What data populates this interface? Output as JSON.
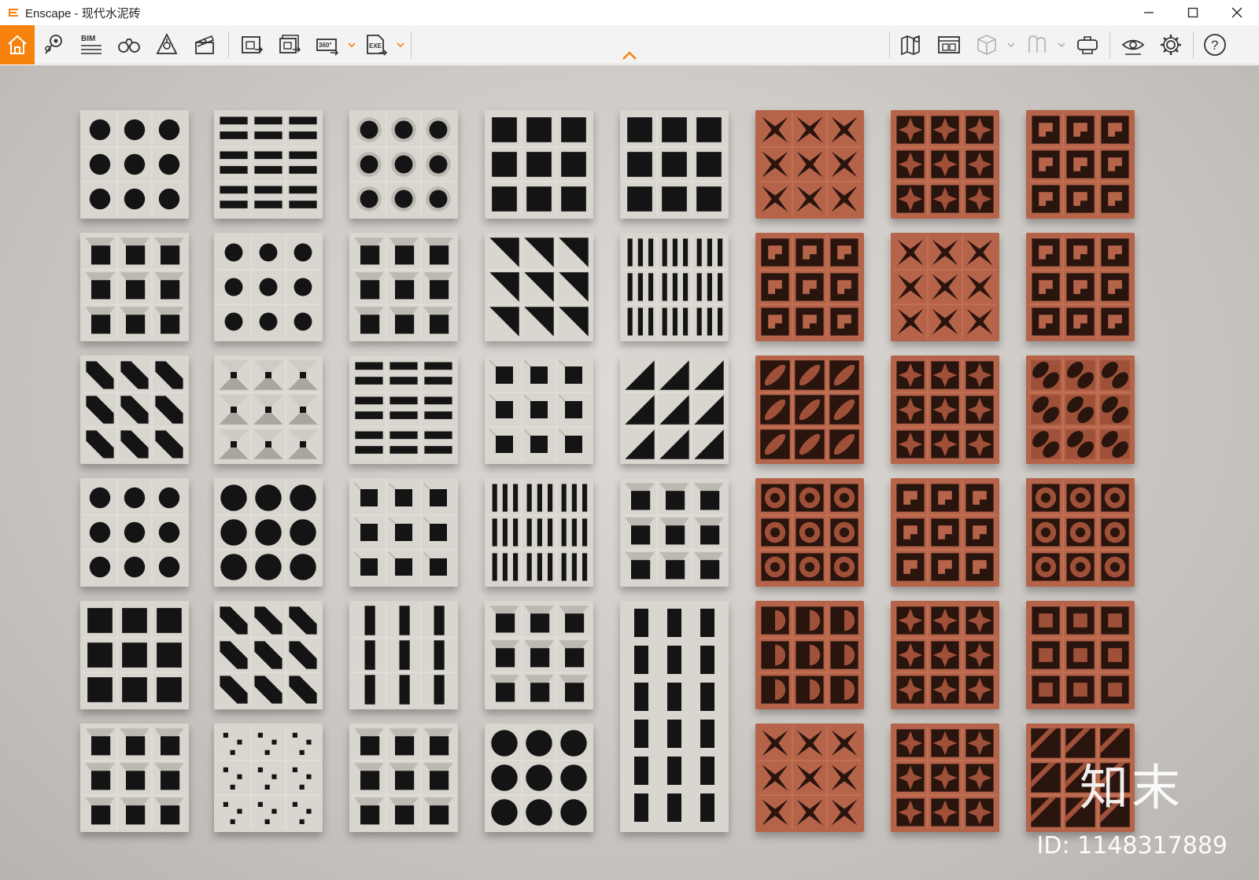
{
  "window": {
    "app_name": "Enscape",
    "separator": " - ",
    "document_name": "现代水泥砖",
    "controls": [
      "minimize-icon",
      "maximize-icon",
      "close-icon"
    ]
  },
  "toolbar": {
    "bim_label": "BIM",
    "panorama_label": "360°",
    "exe_label": "EXE",
    "left_buttons": [
      "home-icon",
      "location-pin-icon",
      "bim-list-icon",
      "binoculars-icon",
      "light-view-icon",
      "clapperboard-icon",
      "screenshot-export-icon",
      "batch-export-icon",
      "panorama-export-icon",
      "exe-export-icon"
    ],
    "right_buttons": [
      "map-icon",
      "asset-library-icon",
      "cube-icon",
      "collaboration-icon",
      "vr-headset-icon",
      "visual-settings-eye-icon",
      "settings-gear-icon",
      "help-icon"
    ],
    "help_glyph": "?",
    "accent_color": "#f7820e"
  },
  "viewport": {
    "watermark_logo": "知末",
    "watermark_id": "ID: 1148317889",
    "tile_colors": {
      "cement": "#d9d6cf",
      "terracotta": "#b5644a"
    },
    "rows": [
      [
        "circle-in-square",
        "stepped-slats",
        "ring-circles",
        "square-grid",
        "square-grid-deep",
        "cross-star",
        "four-point-star",
        "meander"
      ],
      [
        "angled-square",
        "big-circles",
        "angled-square",
        "diagonal-triangles",
        "vertical-bars",
        "key-fret",
        "x-cross",
        "stepped-cross"
      ],
      [
        "diagonal-slash",
        "pyramid-recess",
        "stepped-slats",
        "small-squares",
        "triangles",
        "leaf-ovals",
        "ring-star",
        "quatrefoil"
      ],
      [
        "circles",
        "large-circles",
        "small-squares",
        "vertical-bars",
        "angled-square",
        "circle-ring-ornament",
        "key-fret",
        "square-ring"
      ],
      [
        "square-grid",
        "diagonal-slash",
        "tall-slots",
        "angled-square",
        "tall-column",
        "half-circle",
        "four-point-star",
        "nested-square"
      ],
      [
        "angled-square",
        "scattered-dots",
        "angled-square",
        "large-circles",
        "tall-column",
        "cross-star",
        "quatrefoil-star",
        "diagonal-stripes"
      ]
    ]
  }
}
